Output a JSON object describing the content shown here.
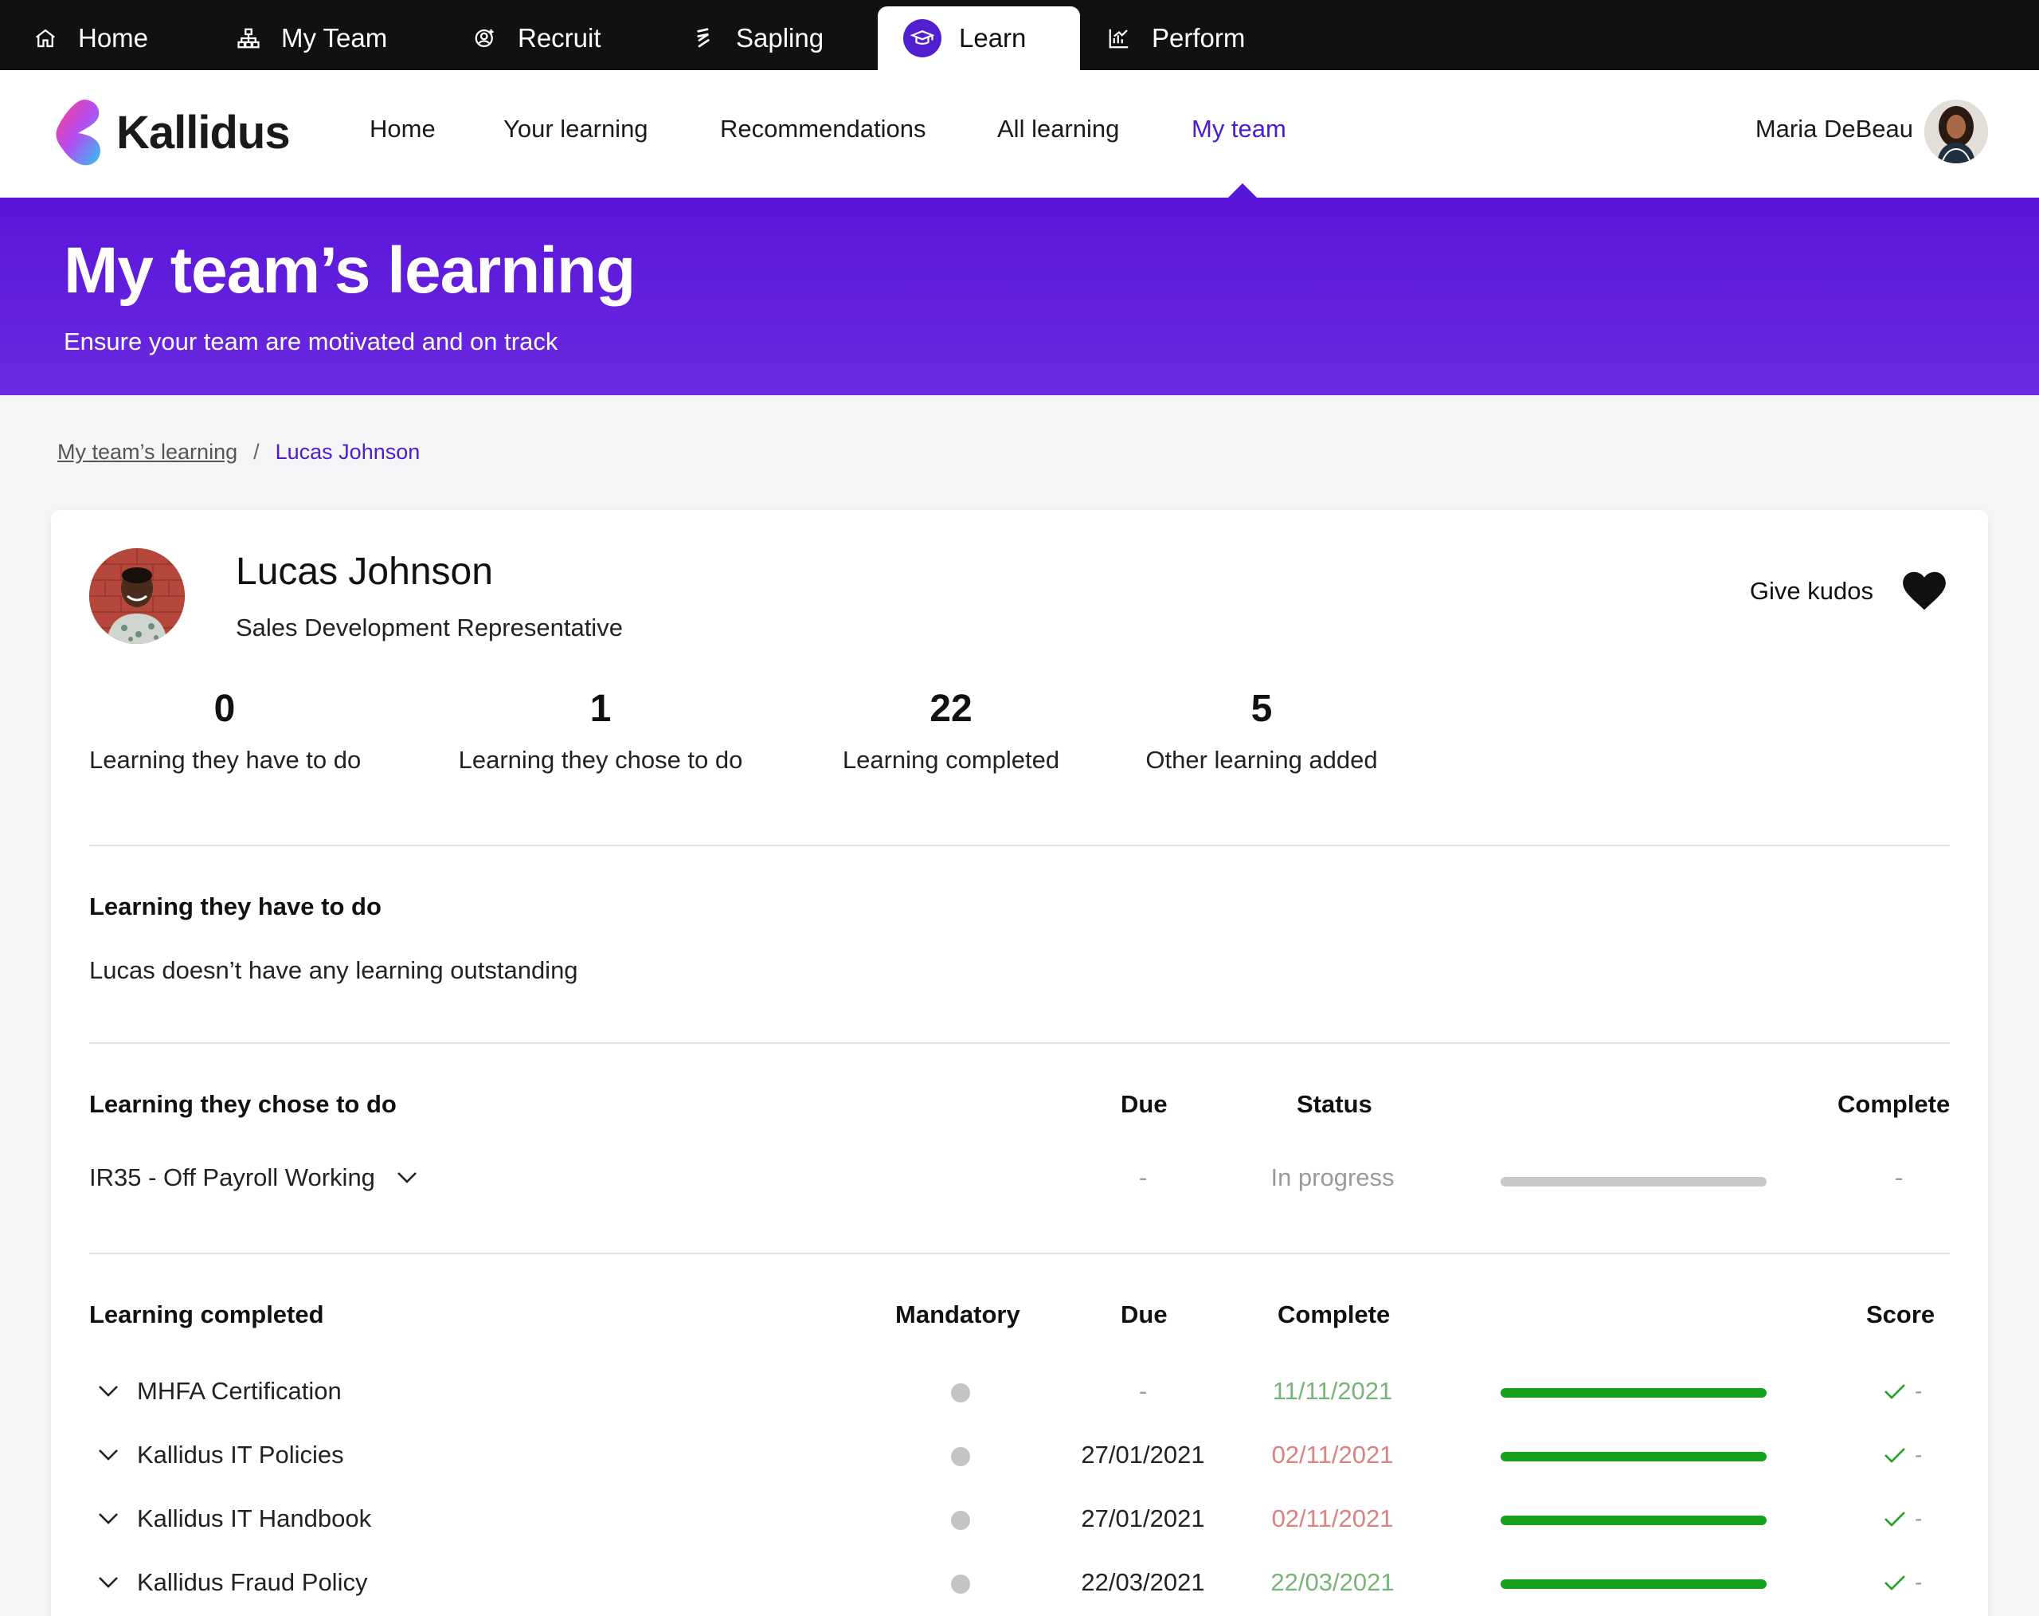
{
  "topnav": {
    "items": [
      {
        "label": "Home",
        "icon": "house-icon"
      },
      {
        "label": "My Team",
        "icon": "org-chart-icon"
      },
      {
        "label": "Recruit",
        "icon": "person-add-icon"
      },
      {
        "label": "Sapling",
        "icon": "sapling-icon"
      },
      {
        "label": "Learn",
        "icon": "graduation-cap-icon",
        "active": true
      },
      {
        "label": "Perform",
        "icon": "chart-icon"
      }
    ]
  },
  "brand": {
    "name": "Kallidus",
    "accent": "#4b1cd0"
  },
  "mainnav": {
    "items": [
      "Home",
      "Your learning",
      "Recommendations",
      "All learning",
      "My team"
    ],
    "active": "My team"
  },
  "user": {
    "name": "Maria DeBeau"
  },
  "hero": {
    "title": "My team’s learning",
    "subtitle": "Ensure your team are motivated and on track"
  },
  "breadcrumb": {
    "parent": "My team’s learning",
    "separator": "/",
    "current": "Lucas Johnson"
  },
  "person": {
    "name": "Lucas Johnson",
    "role": "Sales Development Representative",
    "kudos_label": "Give kudos"
  },
  "stats": [
    {
      "value": "0",
      "label": "Learning they have to do"
    },
    {
      "value": "1",
      "label": "Learning they chose to do"
    },
    {
      "value": "22",
      "label": "Learning completed"
    },
    {
      "value": "5",
      "label": "Other learning added"
    }
  ],
  "have_to_do": {
    "title": "Learning they have to do",
    "empty_text": "Lucas doesn’t have any learning outstanding"
  },
  "chose_to_do": {
    "title": "Learning they chose to do",
    "columns": {
      "due": "Due",
      "status": "Status",
      "complete": "Complete"
    },
    "rows": [
      {
        "title": "IR35 - Off Payroll Working",
        "due": "-",
        "status": "In progress",
        "progress": 0,
        "complete": "-"
      }
    ]
  },
  "completed": {
    "title": "Learning completed",
    "columns": {
      "mandatory": "Mandatory",
      "due": "Due",
      "complete": "Complete",
      "score": "Score"
    },
    "rows": [
      {
        "title": "MHFA Certification",
        "due": "-",
        "complete": "11/11/2021",
        "on_time": true,
        "progress": 100,
        "score": "-"
      },
      {
        "title": "Kallidus IT Policies",
        "due": "27/01/2021",
        "complete": "02/11/2021",
        "on_time": false,
        "progress": 100,
        "score": "-"
      },
      {
        "title": "Kallidus IT Handbook",
        "due": "27/01/2021",
        "complete": "02/11/2021",
        "on_time": false,
        "progress": 100,
        "score": "-"
      },
      {
        "title": "Kallidus Fraud Policy",
        "due": "22/03/2021",
        "complete": "22/03/2021",
        "on_time": true,
        "progress": 100,
        "score": "-"
      }
    ]
  }
}
